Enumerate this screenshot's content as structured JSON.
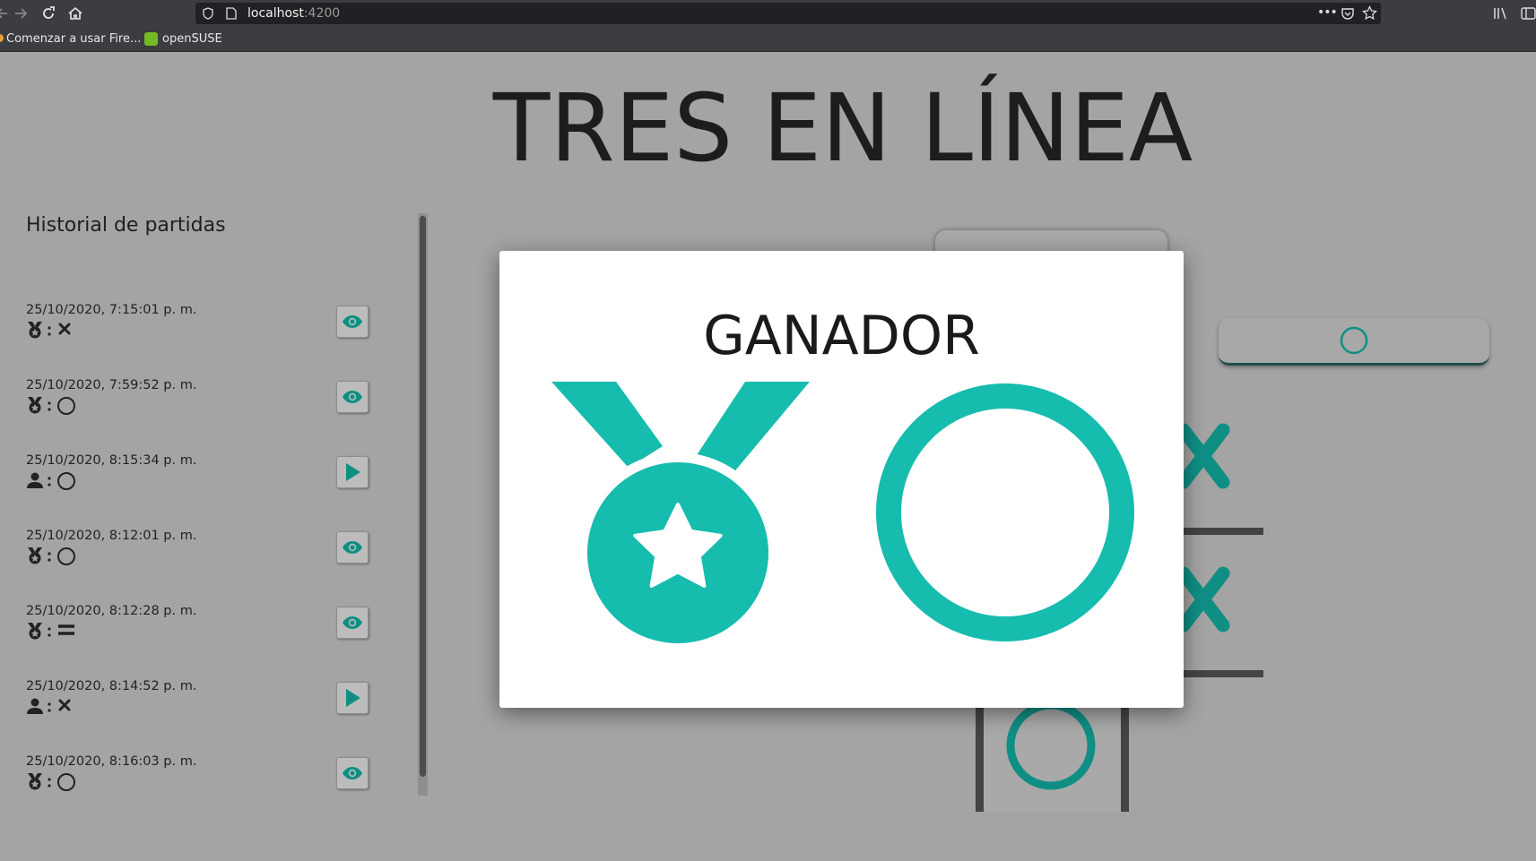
{
  "browser": {
    "url_host": "localhost",
    "url_port": ":4200",
    "bookmarks": [
      {
        "label": "Comenzar a usar Fire..."
      },
      {
        "label": "openSUSE"
      }
    ]
  },
  "page": {
    "title": "TRES EN LÍNEA"
  },
  "history": {
    "title": "Historial de partidas",
    "rows": [
      {
        "date": "25/10/2020, 7:15:01 p. m.",
        "player_icon": "medal-icon",
        "result_icon": "x-icon",
        "action": "view"
      },
      {
        "date": "25/10/2020, 7:59:52 p. m.",
        "player_icon": "medal-icon",
        "result_icon": "circle-icon",
        "action": "view"
      },
      {
        "date": "25/10/2020, 8:15:34 p. m.",
        "player_icon": "user-icon",
        "result_icon": "circle-icon",
        "action": "play"
      },
      {
        "date": "25/10/2020, 8:12:01 p. m.",
        "player_icon": "medal-icon",
        "result_icon": "circle-icon",
        "action": "view"
      },
      {
        "date": "25/10/2020, 8:12:28 p. m.",
        "player_icon": "medal-icon",
        "result_icon": "equals-icon",
        "action": "view"
      },
      {
        "date": "25/10/2020, 8:14:52 p. m.",
        "player_icon": "user-icon",
        "result_icon": "x-icon",
        "action": "play"
      },
      {
        "date": "25/10/2020, 8:16:03 p. m.",
        "player_icon": "medal-icon",
        "result_icon": "circle-icon",
        "action": "view"
      }
    ]
  },
  "modal": {
    "title": "GANADOR",
    "winner_icon": "circle-icon"
  },
  "colors": {
    "accent": "#16bcae",
    "accent_dark": "#0f8f84",
    "overlay_bg": "#a4a4a4"
  }
}
